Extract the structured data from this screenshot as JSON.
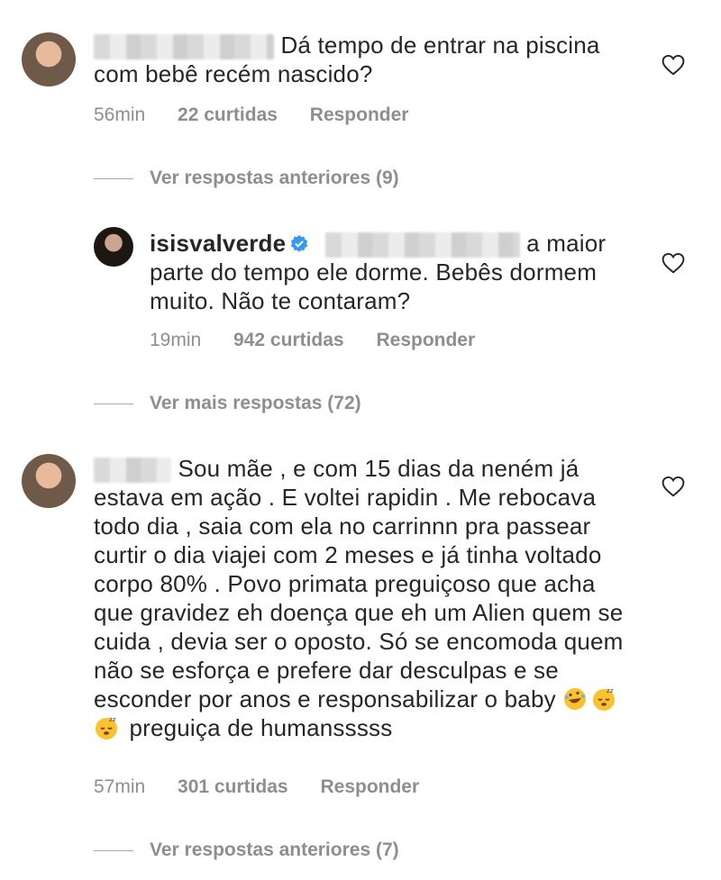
{
  "colors": {
    "text": "#262626",
    "meta": "#8e8e8e",
    "verified": "#3897f0"
  },
  "comments": [
    {
      "text": "Dá tempo de entrar na piscina com bebê recém nascido?",
      "time": "56min",
      "likes": "22 curtidas",
      "reply": "Responder",
      "view_replies": "Ver respostas anteriores (9)",
      "reply_comment": {
        "username": "isisvalverde",
        "text": "a maior parte do tempo ele dorme. Bebês dormem muito. Não te contaram?",
        "time": "19min",
        "likes": "942 curtidas",
        "reply": "Responder"
      },
      "view_more": "Ver mais respostas (72)"
    },
    {
      "text": "Sou mãe , e com 15 dias da neném já estava em ação . E voltei rapidin . Me rebocava todo dia , saia com ela no carrinnn pra passear curtir o dia viajei com 2 meses e já tinha voltado corpo 80% . Povo primata preguiçoso que acha que gravidez eh doença que eh um Alien quem se cuida , devia ser o oposto. Só se encomoda quem não se esforça e prefere dar desculpas e se esconder por anos e responsabilizar o baby",
      "text_end": "preguiça de humansssss",
      "emojis": [
        "rofl-emoji",
        "sleeping-emoji",
        "sleeping-emoji"
      ],
      "time": "57min",
      "likes": "301 curtidas",
      "reply": "Responder",
      "view_replies": "Ver respostas anteriores (7)"
    }
  ]
}
